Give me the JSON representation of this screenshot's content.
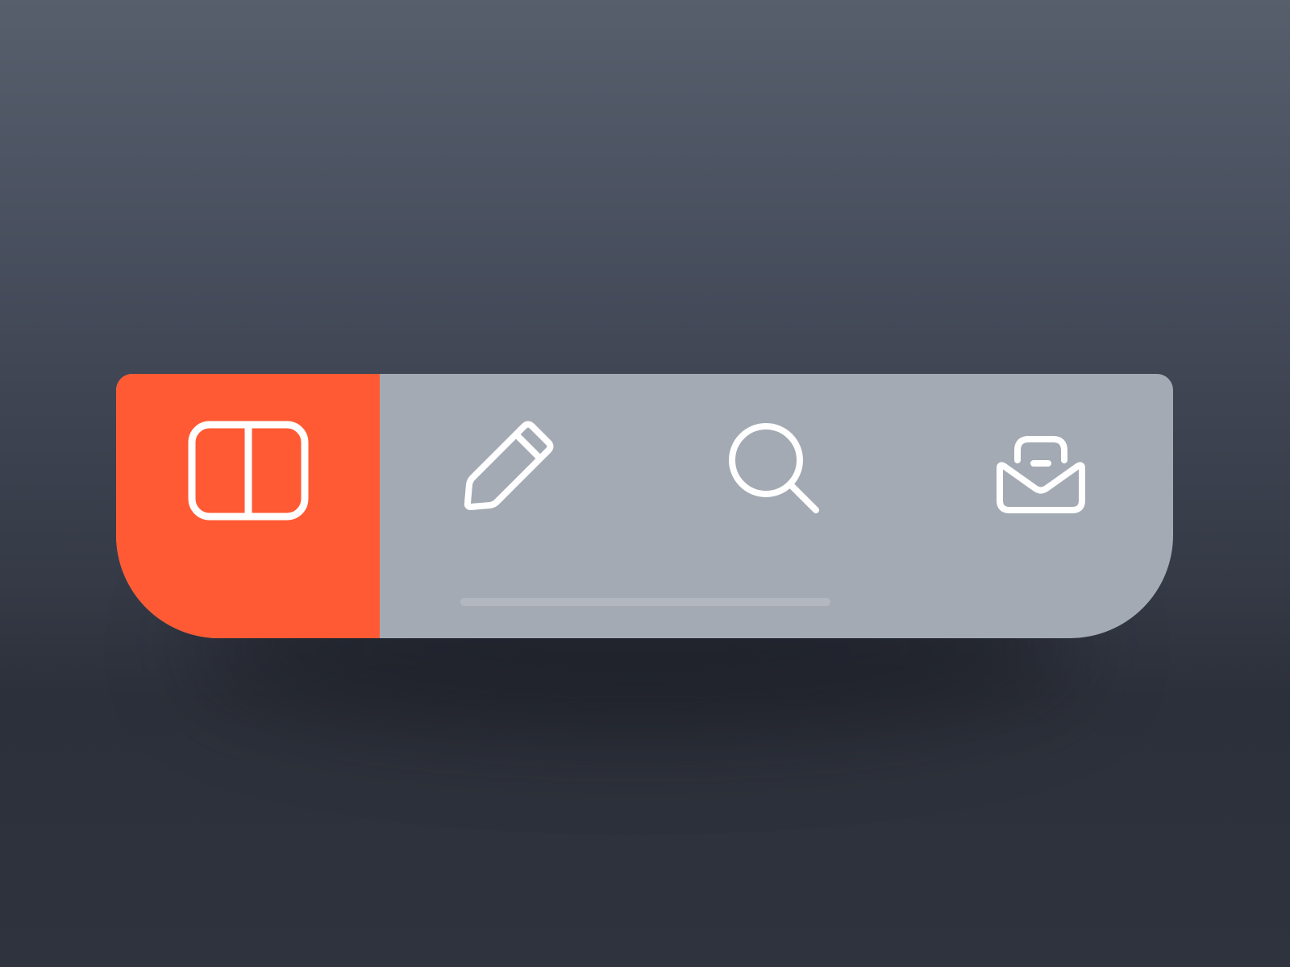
{
  "tabbar": {
    "active_color": "#ff5a33",
    "background_color": "#a4aab3",
    "icon_color": "#ffffff",
    "tabs": [
      {
        "icon": "split-view-icon",
        "active": true
      },
      {
        "icon": "pencil-icon",
        "active": false
      },
      {
        "icon": "search-icon",
        "active": false
      },
      {
        "icon": "inbox-icon",
        "active": false
      }
    ]
  }
}
